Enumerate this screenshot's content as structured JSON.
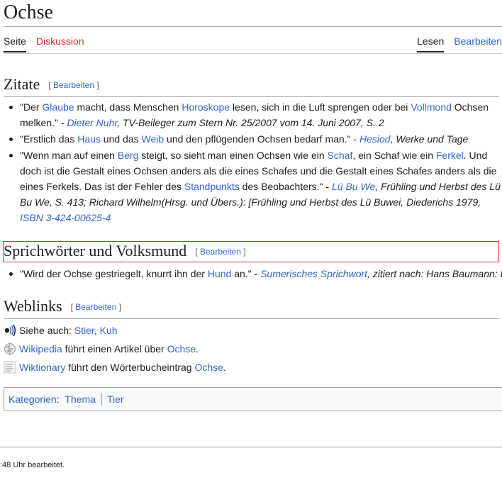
{
  "page": {
    "title": "Ochse"
  },
  "tabs": {
    "left": [
      "Seite",
      "Diskussion"
    ],
    "right": [
      "Lesen",
      "Bearbeiten"
    ]
  },
  "sections": {
    "zitate": {
      "heading": "Zitate",
      "edit_open": "[ ",
      "edit_label": "Bearbeiten",
      "edit_close": " ]"
    },
    "sprich": {
      "heading": "Sprichwörter und Volksmund",
      "edit_open": "[ ",
      "edit_label": "Bearbeiten",
      "edit_close": " ]"
    },
    "weblinks": {
      "heading": "Weblinks",
      "edit_open": "[ ",
      "edit_label": "Bearbeiten",
      "edit_close": " ]"
    }
  },
  "quotes": {
    "q1": {
      "t1": "\"Der ",
      "l1": "Glaube",
      "t2": " macht, dass Menschen ",
      "l2": "Horoskope",
      "t3": " lesen, sich in die Luft sprengen oder bei ",
      "l3": "Vollmond",
      "t4": " Ochsen melken.\" - ",
      "author": "Dieter Nuhr",
      "source": ", TV-Beileger zum Stern Nr. 25/2007 vom 14. Juni 2007, S. 2"
    },
    "q2": {
      "t1": "\"Erstlich das ",
      "l1": "Haus",
      "t2": " und das ",
      "l2": "Weib",
      "t3": " und den pflügenden Ochsen bedarf man.\" - ",
      "author": "Hesiod",
      "source": ", Werke und Tage"
    },
    "q3": {
      "t1": "\"Wenn man auf einen ",
      "l1": "Berg",
      "t2": " steigt, so sieht man einen Ochsen wie ein ",
      "l2": "Schaf",
      "t3": ", ein Schaf wie ein ",
      "l3": "Ferkel",
      "t4": ". Und doch ist die Gestalt eines Ochsen anders als die eines Schafes und die Gestalt eines Schafes anders als die eines Ferkels. Das ist der Fehler des ",
      "l4": "Standpunkts",
      "t5": " des Beobachters.\" - ",
      "author": "Lü Bu We",
      "source": ", Frühling und Herbst des Lü Bu We, S. 413; Richard Wilhelm(Hrsg. und Übers.): [Frühling und Herbst des Lü Buwei, Diederichs 1979, ",
      "isbn": "ISBN 3-424-00625-4"
    },
    "q4": {
      "t1": "\"Wird der Ochse gestriegelt, knurrt ihn der ",
      "l1": "Hund",
      "t2": " an.\" - ",
      "source_link": "Sumerisches Sprichwort",
      "rest": ", zitiert nach: Hans Baumann: D"
    }
  },
  "weblinks": {
    "see_also": {
      "label": "Siehe auch: ",
      "l1": "Stier",
      "comma": ", ",
      "l2": "Kuh",
      "icon": "audio-waves-icon"
    },
    "wikipedia": {
      "l1": "Wikipedia",
      "t1": " führt einen Artikel über ",
      "l2": "Ochse",
      "t2": ".",
      "icon": "wikipedia-globe-icon"
    },
    "wiktionary": {
      "l1": "Wiktionary",
      "t1": " führt den Wörterbucheintrag ",
      "l2": "Ochse",
      "t2": ".",
      "icon": "wiktionary-icon"
    }
  },
  "categories": {
    "label": "Kategorien",
    "colon": ":",
    "items": [
      "Thema",
      "Tier"
    ]
  },
  "footer": {
    "text": ":48 Uhr bearbeitet."
  },
  "colors": {
    "link": "#3366cc",
    "redlink": "#d33",
    "highlight_border": "#d33"
  }
}
